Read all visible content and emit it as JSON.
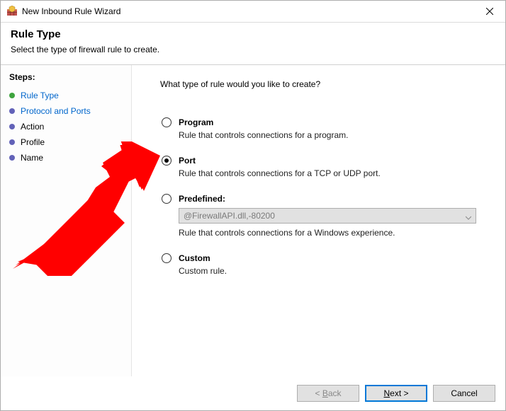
{
  "window": {
    "title": "New Inbound Rule Wizard"
  },
  "header": {
    "title": "Rule Type",
    "subtitle": "Select the type of firewall rule to create."
  },
  "sidebar": {
    "title": "Steps:",
    "items": [
      {
        "label": "Rule Type"
      },
      {
        "label": "Protocol and Ports"
      },
      {
        "label": "Action"
      },
      {
        "label": "Profile"
      },
      {
        "label": "Name"
      }
    ]
  },
  "content": {
    "question": "What type of rule would you like to create?",
    "options": {
      "program": {
        "label": "Program",
        "desc": "Rule that controls connections for a program."
      },
      "port": {
        "label": "Port",
        "desc": "Rule that controls connections for a TCP or UDP port."
      },
      "predefined": {
        "label": "Predefined:",
        "dropdown_value": "@FirewallAPI.dll,-80200",
        "desc": "Rule that controls connections for a Windows experience."
      },
      "custom": {
        "label": "Custom",
        "desc": "Custom rule."
      }
    }
  },
  "footer": {
    "back": "Back",
    "next": "Next",
    "cancel": "Cancel"
  }
}
